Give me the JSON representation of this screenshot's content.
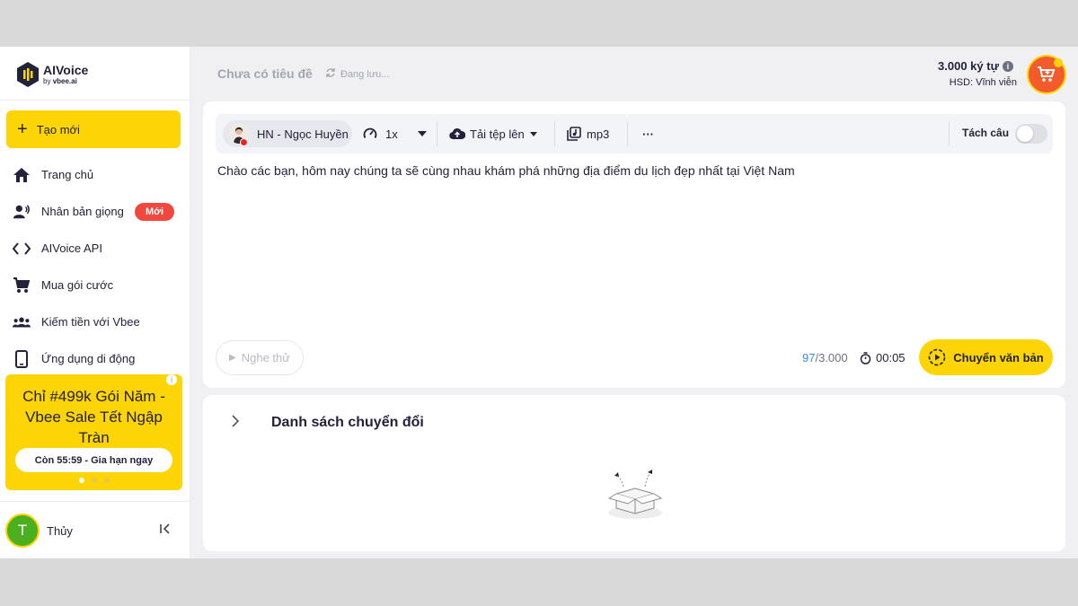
{
  "brand": {
    "name": "AIVoice",
    "by": "by",
    "sub": "vbee.ai"
  },
  "sidebar": {
    "new_label": "Tạo mới",
    "items": [
      {
        "label": "Trang chủ",
        "icon": "home-icon"
      },
      {
        "label": "Nhân bản giọng",
        "icon": "voice-clone-icon",
        "badge": "Mới"
      },
      {
        "label": "AIVoice API",
        "icon": "code-icon"
      },
      {
        "label": "Mua gói cước",
        "icon": "cart-icon"
      },
      {
        "label": "Kiếm tiền với Vbee",
        "icon": "group-icon"
      },
      {
        "label": "Ứng dụng di động",
        "icon": "phone-icon"
      }
    ],
    "promo": {
      "text": "Chỉ #499k Gói Năm - Vbee Sale Tết Ngập Tràn",
      "button": "Còn 55:59 - Gia hạn ngay",
      "slides": 3,
      "active_slide": 0
    },
    "user": {
      "initial": "T",
      "name": "Thủy"
    }
  },
  "header": {
    "title": "Chưa có tiêu đề",
    "saving": "Đang lưu...",
    "credits": "3.000 ký tự",
    "expiry": "HSD: Vĩnh viễn"
  },
  "toolbar": {
    "voice": "HN - Ngọc Huyền",
    "speed": "1x",
    "upload": "Tải tệp lên",
    "format": "mp3",
    "more": "···",
    "split_label": "Tách câu",
    "split_on": false
  },
  "editor": {
    "text": "Chào các bạn, hôm nay chúng ta sẽ cùng nhau khám phá những địa điểm du lịch đẹp nhất tại Việt Nam",
    "listen": "Nghe thử",
    "count_current": "97",
    "count_max": "/3.000",
    "duration": "00:05",
    "convert": "Chuyển văn bản"
  },
  "list": {
    "title": "Danh sách chuyển đổi"
  },
  "colors": {
    "accent": "#fdd506",
    "danger": "#f0483e",
    "cart": "#f35b2c",
    "avatar": "#4caf20"
  }
}
